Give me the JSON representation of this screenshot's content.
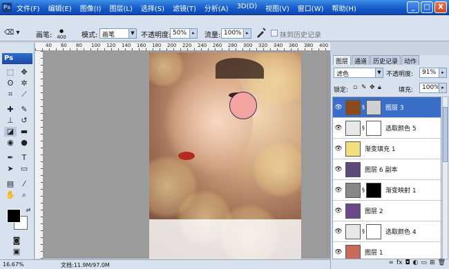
{
  "app": {
    "logo": "Ps"
  },
  "menu": [
    "文件(F)",
    "编辑(E)",
    "图像(I)",
    "图层(L)",
    "选择(S)",
    "滤镜(T)",
    "分析(A)",
    "3D(D)",
    "视图(V)",
    "窗口(W)",
    "帮助(H)"
  ],
  "window_buttons": [
    "_",
    "□",
    "X"
  ],
  "options": {
    "brush_label": "画笔:",
    "brush_size": "400",
    "mode_label": "模式:",
    "mode_value": "画笔",
    "opacity_label": "不透明度:",
    "opacity_value": "50%",
    "flow_label": "流量:",
    "flow_value": "100%",
    "history_label": "抹到历史记录"
  },
  "rulers": [
    "40",
    "60",
    "80",
    "100",
    "120",
    "140",
    "160",
    "180",
    "200",
    "220",
    "240",
    "260",
    "280",
    "300",
    "320",
    "340",
    "360",
    "380",
    "400"
  ],
  "status": {
    "zoom": "16.67%",
    "doc": "文档:11.9M/97.0M"
  },
  "panel": {
    "tabs": [
      "图层",
      "通道",
      "历史记录",
      "动作"
    ],
    "blend_mode": "滤色",
    "opacity_label": "不透明度:",
    "opacity_value": "91%",
    "lock_label": "锁定:",
    "fill_label": "填充:",
    "fill_value": "100%",
    "layers": [
      {
        "name": "图层 3",
        "selected": true,
        "thumb": "#8a4a1a",
        "mask": "#d0d0d0"
      },
      {
        "name": "选取颜色 5",
        "selected": false,
        "thumb": "#e8e8e8",
        "mask": "#ffffff"
      },
      {
        "name": "渐变填充 1",
        "selected": false,
        "thumb": "#f4e07a",
        "mask": ""
      },
      {
        "name": "图层 6 副本",
        "selected": false,
        "thumb": "#5b4b7a",
        "mask": ""
      },
      {
        "name": "渐变映射 1",
        "selected": false,
        "thumb": "#888888",
        "mask": "#000000"
      },
      {
        "name": "图层 2",
        "selected": false,
        "thumb": "#6a4a8a",
        "mask": ""
      },
      {
        "name": "选取颜色 4",
        "selected": false,
        "thumb": "#e8e8e8",
        "mask": "#ffffff"
      },
      {
        "name": "图层 1",
        "selected": false,
        "thumb": "#c86a5a",
        "mask": ""
      }
    ]
  }
}
